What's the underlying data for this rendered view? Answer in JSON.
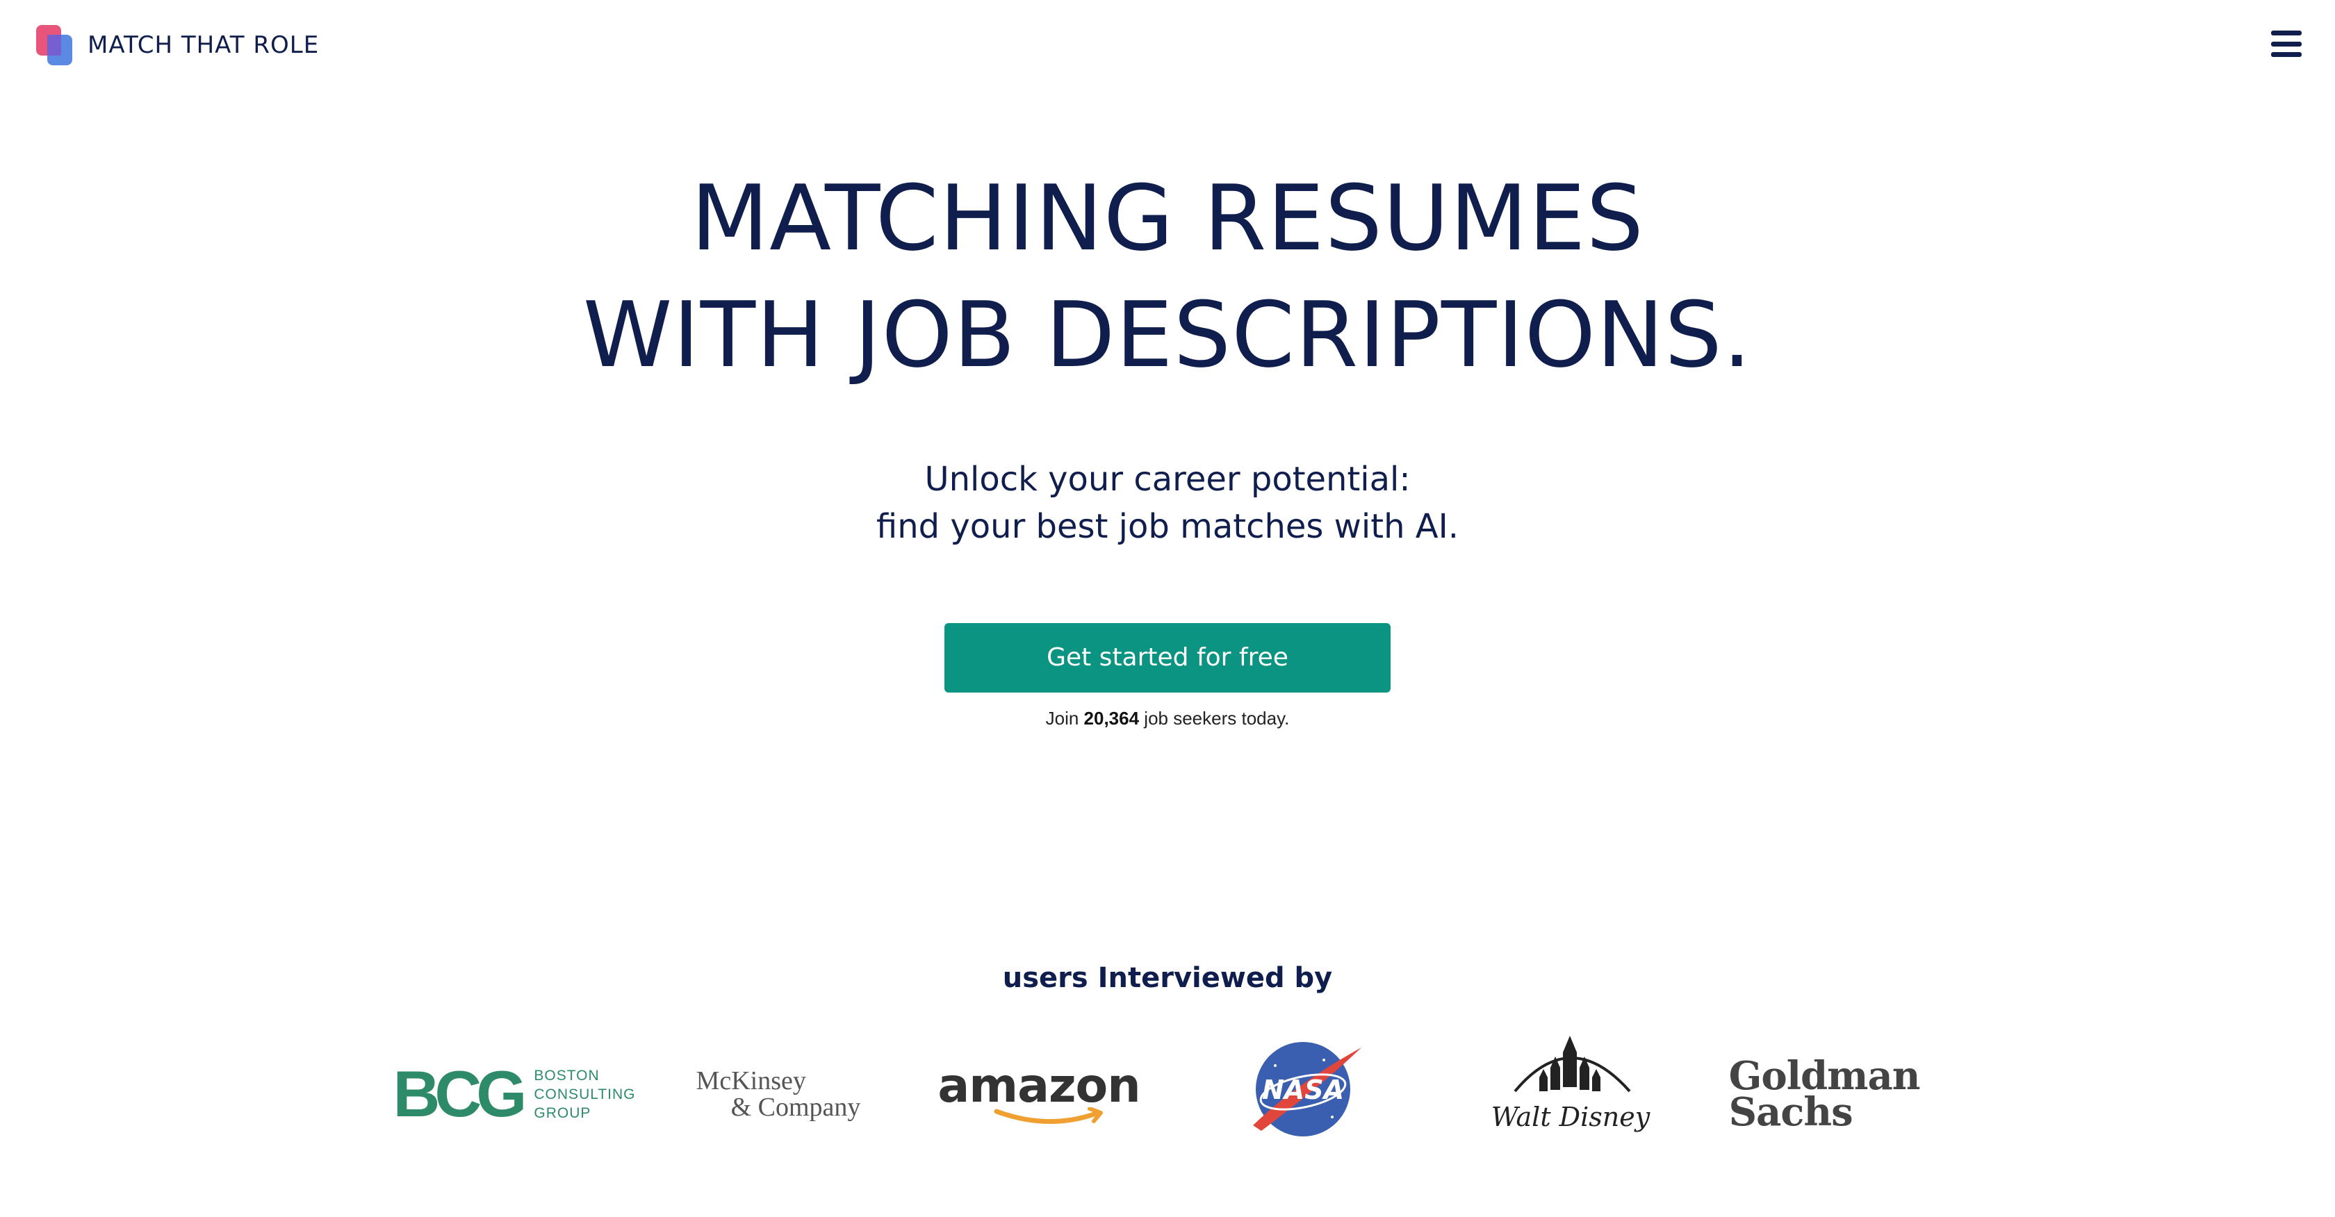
{
  "header": {
    "brand_name": "MATCH THAT ROLE",
    "menu_icon": "hamburger-menu-icon"
  },
  "hero": {
    "title_line1": "MATCHING RESUMES",
    "title_line2": "WITH JOB DESCRIPTIONS.",
    "subtitle_line1": "Unlock your career potential:",
    "subtitle_line2": "find your best job matches with AI.",
    "cta_label": "Get started for free",
    "join_prefix": "Join ",
    "join_count": "20,364",
    "join_suffix": " job seekers today."
  },
  "logos": {
    "heading": "users Interviewed by",
    "items": [
      {
        "name": "BCG",
        "lines": [
          "BOSTON",
          "CONSULTING",
          "GROUP"
        ]
      },
      {
        "name": "McKinsey & Company",
        "lines": [
          "McKinsey",
          "& Company"
        ]
      },
      {
        "name": "amazon"
      },
      {
        "name": "NASA"
      },
      {
        "name": "Walt Disney"
      },
      {
        "name": "Goldman Sachs",
        "lines": [
          "Goldman",
          "Sachs"
        ]
      }
    ]
  },
  "colors": {
    "navy": "#0f1e4d",
    "cta": "#0a9481",
    "bcg_green": "#2e8b6a",
    "amazon_orange": "#f0a030",
    "nasa_blue": "#3a5fb0",
    "nasa_red": "#e0463c",
    "logo_pink": "#e8557a",
    "logo_blue": "#4a7de0"
  }
}
